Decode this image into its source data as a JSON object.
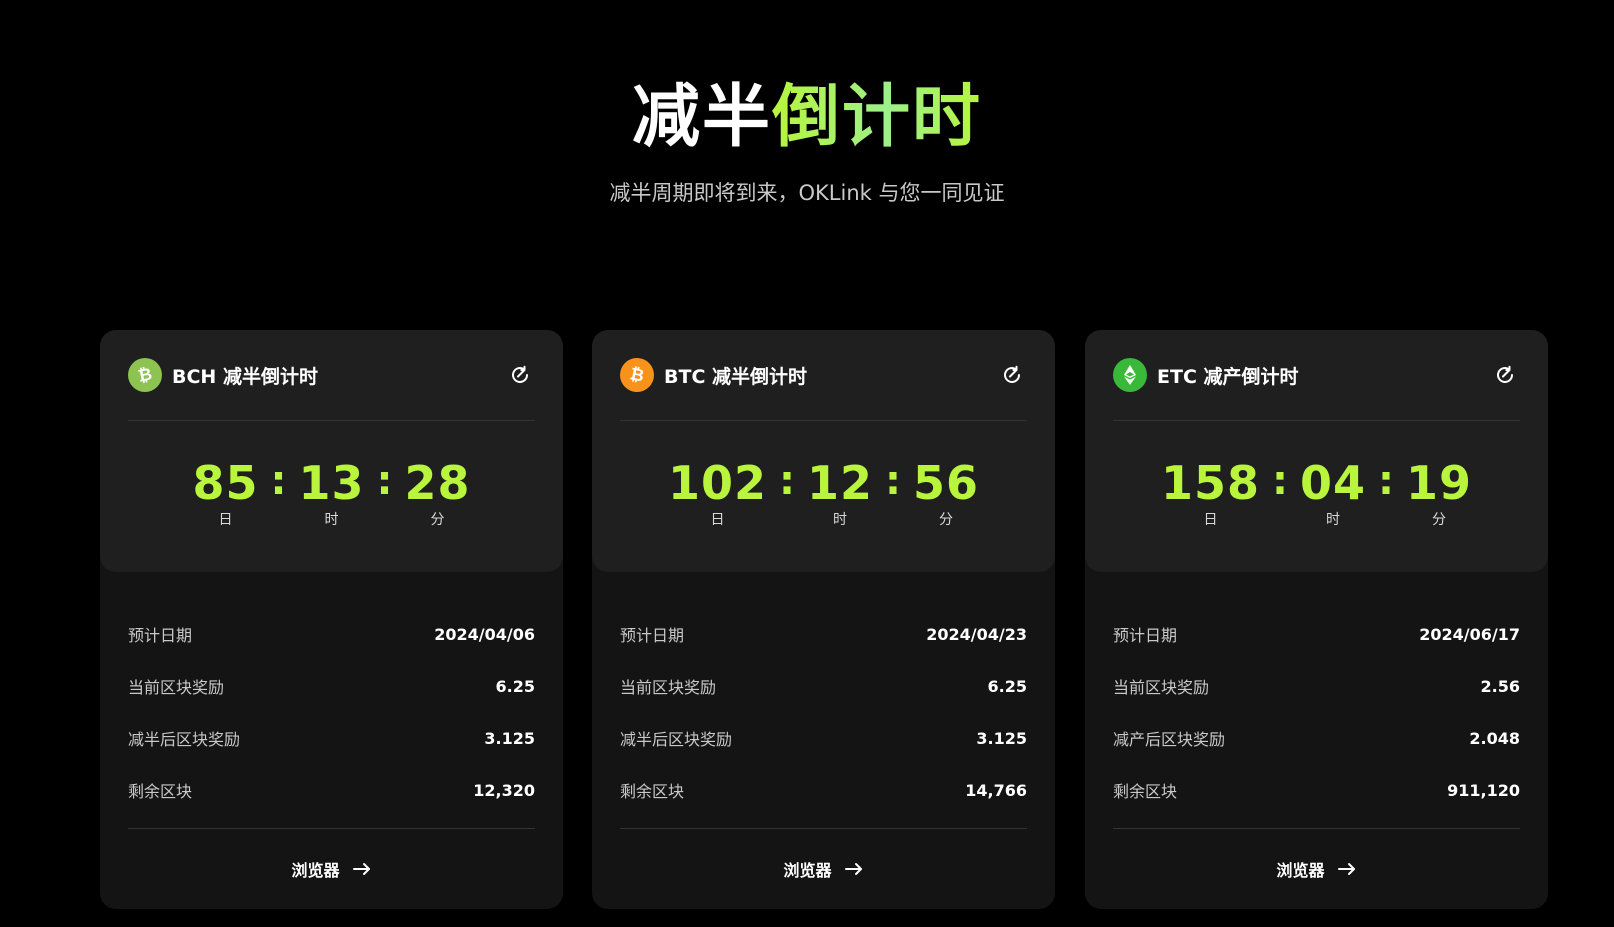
{
  "hero": {
    "title_part1": "减半",
    "title_part2": "倒计时",
    "subtitle": "减半周期即将到来，OKLink 与您一同见证"
  },
  "colors": {
    "accent": "#b8f53c",
    "bch": "#8dc351",
    "btc": "#f7931a",
    "etc": "#3ab83a"
  },
  "cards": [
    {
      "coin_icon": "bitcoin-cash-icon",
      "title": "BCH 减半倒计时",
      "countdown": {
        "days": "85",
        "hours": "13",
        "minutes": "28",
        "days_label": "日",
        "hours_label": "时",
        "minutes_label": "分",
        "separator": ":"
      },
      "rows": [
        {
          "label": "预计日期",
          "value": "2024/04/06"
        },
        {
          "label": "当前区块奖励",
          "value": "6.25"
        },
        {
          "label": "减半后区块奖励",
          "value": "3.125"
        },
        {
          "label": "剩余区块",
          "value": "12,320"
        }
      ],
      "browser_label": "浏览器"
    },
    {
      "coin_icon": "bitcoin-icon",
      "title": "BTC 减半倒计时",
      "countdown": {
        "days": "102",
        "hours": "12",
        "minutes": "56",
        "days_label": "日",
        "hours_label": "时",
        "minutes_label": "分",
        "separator": ":"
      },
      "rows": [
        {
          "label": "预计日期",
          "value": "2024/04/23"
        },
        {
          "label": "当前区块奖励",
          "value": "6.25"
        },
        {
          "label": "减半后区块奖励",
          "value": "3.125"
        },
        {
          "label": "剩余区块",
          "value": "14,766"
        }
      ],
      "browser_label": "浏览器"
    },
    {
      "coin_icon": "ethereum-classic-icon",
      "title": "ETC 减产倒计时",
      "countdown": {
        "days": "158",
        "hours": "04",
        "minutes": "19",
        "days_label": "日",
        "hours_label": "时",
        "minutes_label": "分",
        "separator": ":"
      },
      "rows": [
        {
          "label": "预计日期",
          "value": "2024/06/17"
        },
        {
          "label": "当前区块奖励",
          "value": "2.56"
        },
        {
          "label": "减产后区块奖励",
          "value": "2.048"
        },
        {
          "label": "剩余区块",
          "value": "911,120"
        }
      ],
      "browser_label": "浏览器"
    }
  ]
}
